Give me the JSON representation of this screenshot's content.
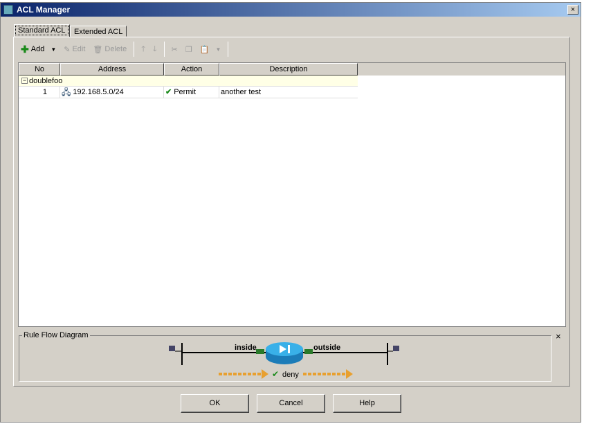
{
  "window": {
    "title": "ACL Manager",
    "close": "×"
  },
  "tabs": [
    {
      "label": "Standard ACL"
    },
    {
      "label": "Extended ACL"
    }
  ],
  "toolbar": {
    "add": "Add",
    "edit": "Edit",
    "delete": "Delete"
  },
  "table": {
    "columns": [
      "No",
      "Address",
      "Action",
      "Description"
    ],
    "group": "doublefoo",
    "rows": [
      {
        "no": "1",
        "address": "192.168.5.0/24",
        "action": "Permit",
        "description": "another test"
      }
    ]
  },
  "diagram": {
    "title": "Rule Flow Diagram",
    "inside": "inside",
    "outside": "outside",
    "action": "deny",
    "close": "×"
  },
  "buttons": {
    "ok": "OK",
    "cancel": "Cancel",
    "help": "Help"
  },
  "side_id": "157436"
}
